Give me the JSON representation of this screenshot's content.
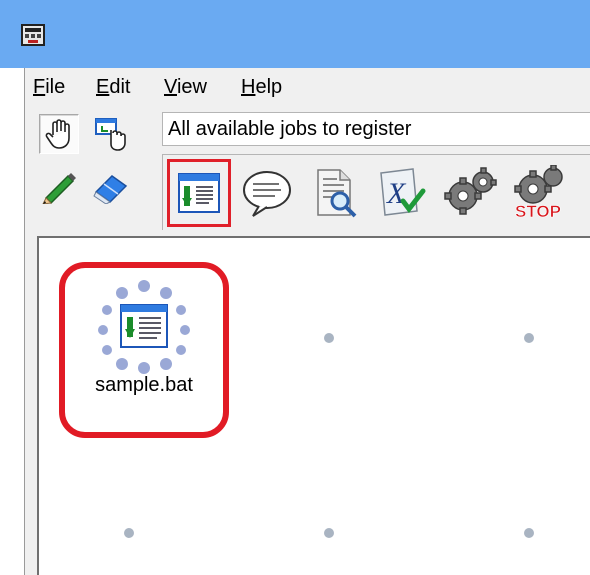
{
  "menu": {
    "file": {
      "mnemonic": "F",
      "rest": "ile"
    },
    "edit": {
      "mnemonic": "E",
      "rest": "dit"
    },
    "view": {
      "mnemonic": "V",
      "rest": "iew"
    },
    "help": {
      "mnemonic": "H",
      "rest": "elp"
    }
  },
  "tools": {
    "hand": "hand-tool-icon",
    "pointer": "pointer-tool-icon",
    "pencil": "pencil-tool-icon",
    "eraser": "eraser-tool-icon"
  },
  "jobs_label": "All available jobs to register",
  "palette": [
    {
      "icon": "job-window-icon",
      "selected": true
    },
    {
      "icon": "speech-bubble-icon",
      "selected": false
    },
    {
      "icon": "document-search-icon",
      "selected": false
    },
    {
      "icon": "variable-check-icon",
      "selected": false
    },
    {
      "icon": "gear-icon",
      "selected": false
    },
    {
      "icon": "gear-stop-icon",
      "selected": false,
      "text": "STOP"
    }
  ],
  "canvas": {
    "job": {
      "label": "sample.bat"
    }
  },
  "colors": {
    "titlebar": "#6aaaf2",
    "selection": "#e11b25",
    "grid_dot": "#a9b4c2"
  }
}
